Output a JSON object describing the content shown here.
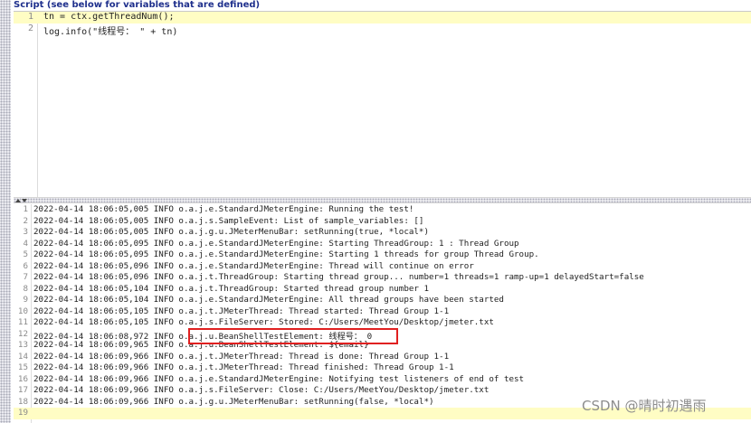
{
  "script_panel": {
    "header": "Script (see below for variables that are defined)",
    "lines": [
      {
        "num": "1",
        "code": "tn = ctx.getThreadNum();"
      },
      {
        "num": "2",
        "code": "log.info(\"线程号： \" + tn)"
      }
    ]
  },
  "log_panel": {
    "lines": [
      {
        "num": "1",
        "text": "2022-04-14 18:06:05,005 INFO o.a.j.e.StandardJMeterEngine: Running the test!"
      },
      {
        "num": "2",
        "text": "2022-04-14 18:06:05,005 INFO o.a.j.s.SampleEvent: List of sample_variables: []"
      },
      {
        "num": "3",
        "text": "2022-04-14 18:06:05,005 INFO o.a.j.g.u.JMeterMenuBar: setRunning(true, *local*)"
      },
      {
        "num": "4",
        "text": "2022-04-14 18:06:05,095 INFO o.a.j.e.StandardJMeterEngine: Starting ThreadGroup: 1 : Thread Group"
      },
      {
        "num": "5",
        "text": "2022-04-14 18:06:05,095 INFO o.a.j.e.StandardJMeterEngine: Starting 1 threads for group Thread Group."
      },
      {
        "num": "6",
        "text": "2022-04-14 18:06:05,096 INFO o.a.j.e.StandardJMeterEngine: Thread will continue on error"
      },
      {
        "num": "7",
        "text": "2022-04-14 18:06:05,096 INFO o.a.j.t.ThreadGroup: Starting thread group... number=1 threads=1 ramp-up=1 delayedStart=false"
      },
      {
        "num": "8",
        "text": "2022-04-14 18:06:05,104 INFO o.a.j.t.ThreadGroup: Started thread group number 1"
      },
      {
        "num": "9",
        "text": "2022-04-14 18:06:05,104 INFO o.a.j.e.StandardJMeterEngine: All thread groups have been started"
      },
      {
        "num": "10",
        "text": "2022-04-14 18:06:05,105 INFO o.a.j.t.JMeterThread: Thread started: Thread Group 1-1"
      },
      {
        "num": "11",
        "text": "2022-04-14 18:06:05,105 INFO o.a.j.s.FileServer: Stored: C:/Users/MeetYou/Desktop/jmeter.txt"
      },
      {
        "num": "12",
        "text": "2022-04-14 18:06:08,972 INFO o.a.j.u.BeanShellTestElement: 线程号： 0"
      },
      {
        "num": "13",
        "text": "2022-04-14 18:06:09,965 INFO o.a.j.u.BeanShellTestElement: ${email}"
      },
      {
        "num": "14",
        "text": "2022-04-14 18:06:09,966 INFO o.a.j.t.JMeterThread: Thread is done: Thread Group 1-1"
      },
      {
        "num": "15",
        "text": "2022-04-14 18:06:09,966 INFO o.a.j.t.JMeterThread: Thread finished: Thread Group 1-1"
      },
      {
        "num": "16",
        "text": "2022-04-14 18:06:09,966 INFO o.a.j.e.StandardJMeterEngine: Notifying test listeners of end of test"
      },
      {
        "num": "17",
        "text": "2022-04-14 18:06:09,966 INFO o.a.j.s.FileServer: Close: C:/Users/MeetYou/Desktop/jmeter.txt"
      },
      {
        "num": "18",
        "text": "2022-04-14 18:06:09,966 INFO o.a.j.g.u.JMeterMenuBar: setRunning(false, *local*)"
      },
      {
        "num": "19",
        "text": ""
      }
    ]
  },
  "watermark": "CSDN @晴时初遇雨",
  "colors": {
    "highlight_box": "#e02020",
    "current_line": "#fffdc4",
    "header_text": "#1e2f8c"
  }
}
